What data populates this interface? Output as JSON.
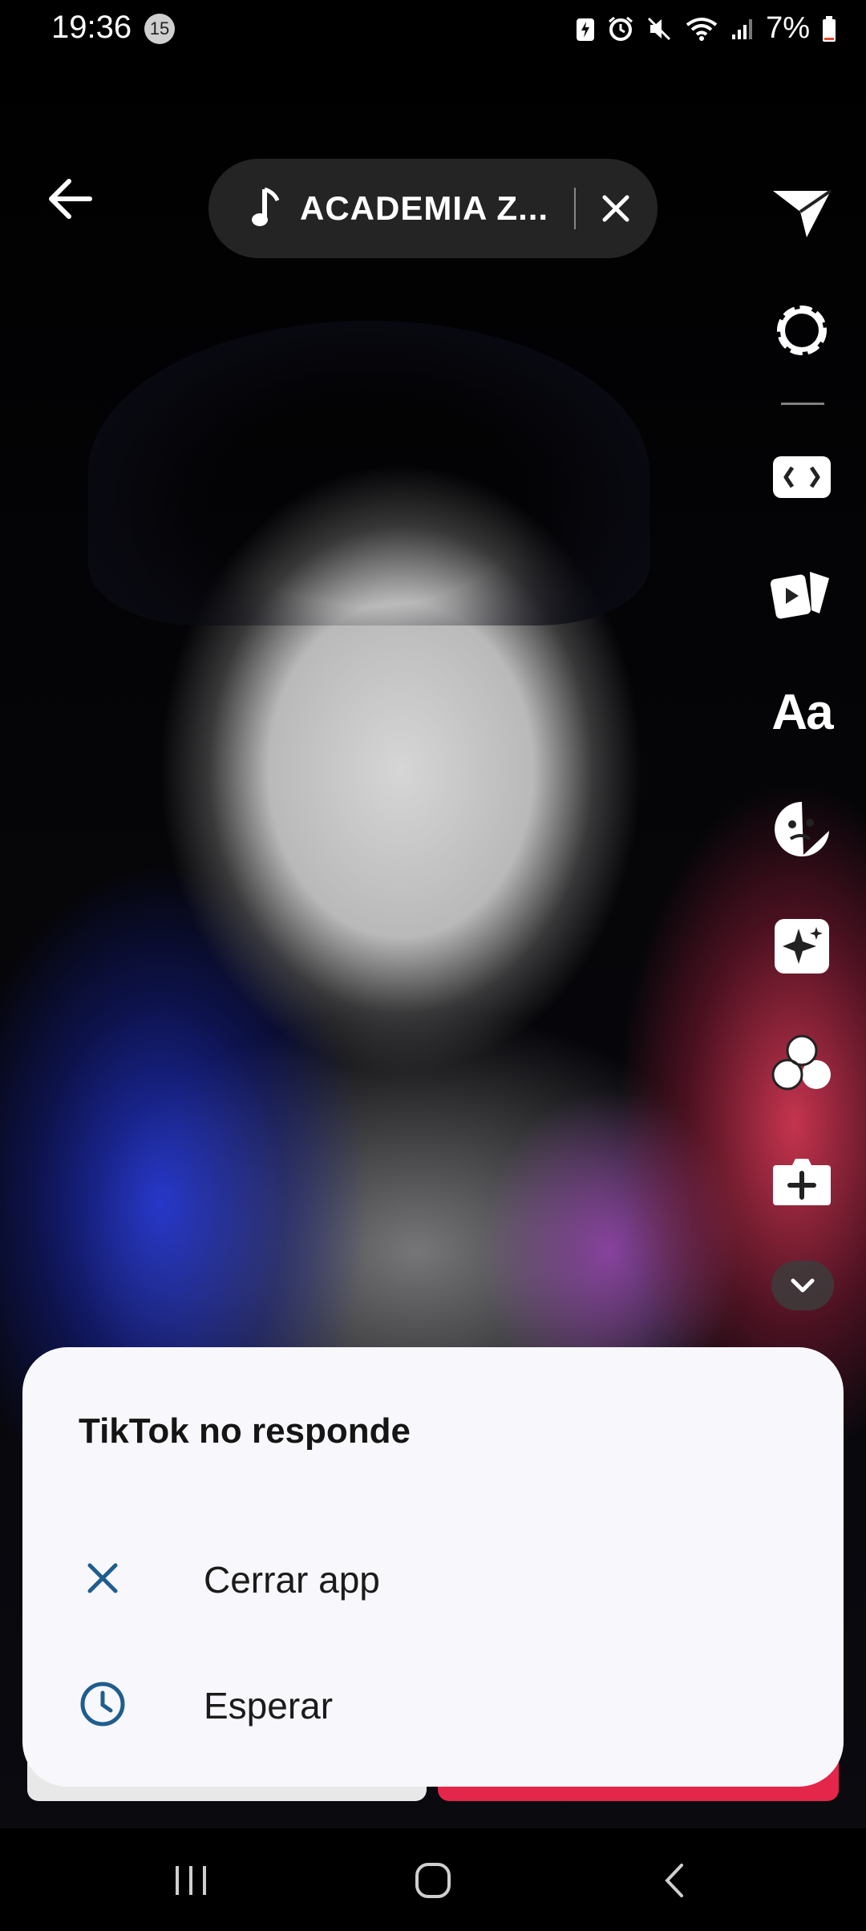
{
  "status_bar": {
    "time": "19:36",
    "notification_count": "15",
    "battery": "7%"
  },
  "music": {
    "title": "ACADEMIA Z..."
  },
  "toolbar": {
    "text_tool_label": "Aa",
    "icons": [
      "send-icon",
      "settings-icon",
      "flip-icon",
      "templates-icon",
      "text-icon",
      "sticker-icon",
      "effects-icon",
      "filters-icon",
      "add-clip-icon",
      "chevron-down-icon"
    ]
  },
  "dialog": {
    "title": "TikTok no responde",
    "close_label": "Cerrar app",
    "wait_label": "Esperar"
  },
  "colors": {
    "accent": "#1f5d8f",
    "dialog_bg": "#f8f8fc",
    "post_button": "#e3264a"
  }
}
